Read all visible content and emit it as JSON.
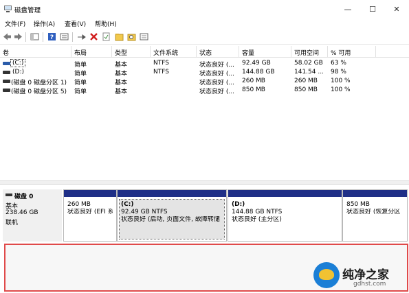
{
  "window": {
    "title": "磁盘管理",
    "minimize": "—",
    "maximize": "☐",
    "close": "✕"
  },
  "menu": [
    "文件(F)",
    "操作(A)",
    "查看(V)",
    "帮助(H)"
  ],
  "toolbar_icons": [
    "back-icon",
    "forward-icon",
    "console-tree-icon",
    "help-icon",
    "properties-icon",
    "connect-icon",
    "delete-icon",
    "checkmark-doc-icon",
    "new-folder-icon",
    "search-icon",
    "list-icon"
  ],
  "columns": [
    "卷",
    "布局",
    "类型",
    "文件系统",
    "状态",
    "容量",
    "可用空间",
    "% 可用"
  ],
  "volumes": [
    {
      "name": "(C:)",
      "layout": "简单",
      "type": "基本",
      "fs": "NTFS",
      "status": "状态良好 (...",
      "capacity": "92.49 GB",
      "free": "58.02 GB",
      "pct": "63 %",
      "selected": true
    },
    {
      "name": "(D:)",
      "layout": "简单",
      "type": "基本",
      "fs": "NTFS",
      "status": "状态良好 (...",
      "capacity": "144.88 GB",
      "free": "141.54 ...",
      "pct": "98 %",
      "selected": false
    },
    {
      "name": "(磁盘 0 磁盘分区 1)",
      "layout": "简单",
      "type": "基本",
      "fs": "",
      "status": "状态良好 (...",
      "capacity": "260 MB",
      "free": "260 MB",
      "pct": "100 %",
      "selected": false
    },
    {
      "name": "(磁盘 0 磁盘分区 5)",
      "layout": "简单",
      "type": "基本",
      "fs": "",
      "status": "状态良好 (...",
      "capacity": "850 MB",
      "free": "850 MB",
      "pct": "100 %",
      "selected": false
    }
  ],
  "disk": {
    "name": "磁盘 0",
    "type": "基本",
    "size": "238.46 GB",
    "state": "联机"
  },
  "partitions": [
    {
      "label": "",
      "size": "260 MB",
      "status": "状态良好 (EFI 系",
      "selected": false
    },
    {
      "label": "(C:)",
      "size": "92.49 GB NTFS",
      "status": "状态良好 (启动, 页面文件, 故障转储",
      "selected": true
    },
    {
      "label": "(D:)",
      "size": "144.88 GB NTFS",
      "status": "状态良好 (主分区)",
      "selected": false
    },
    {
      "label": "",
      "size": "850 MB",
      "status": "状态良好 (恢复分区",
      "selected": false
    }
  ],
  "watermark": {
    "text": "纯净之家",
    "url": "gdhst.com"
  },
  "colors": {
    "partition_bar": "#1f2f87",
    "highlight_box": "#e04a4a"
  }
}
